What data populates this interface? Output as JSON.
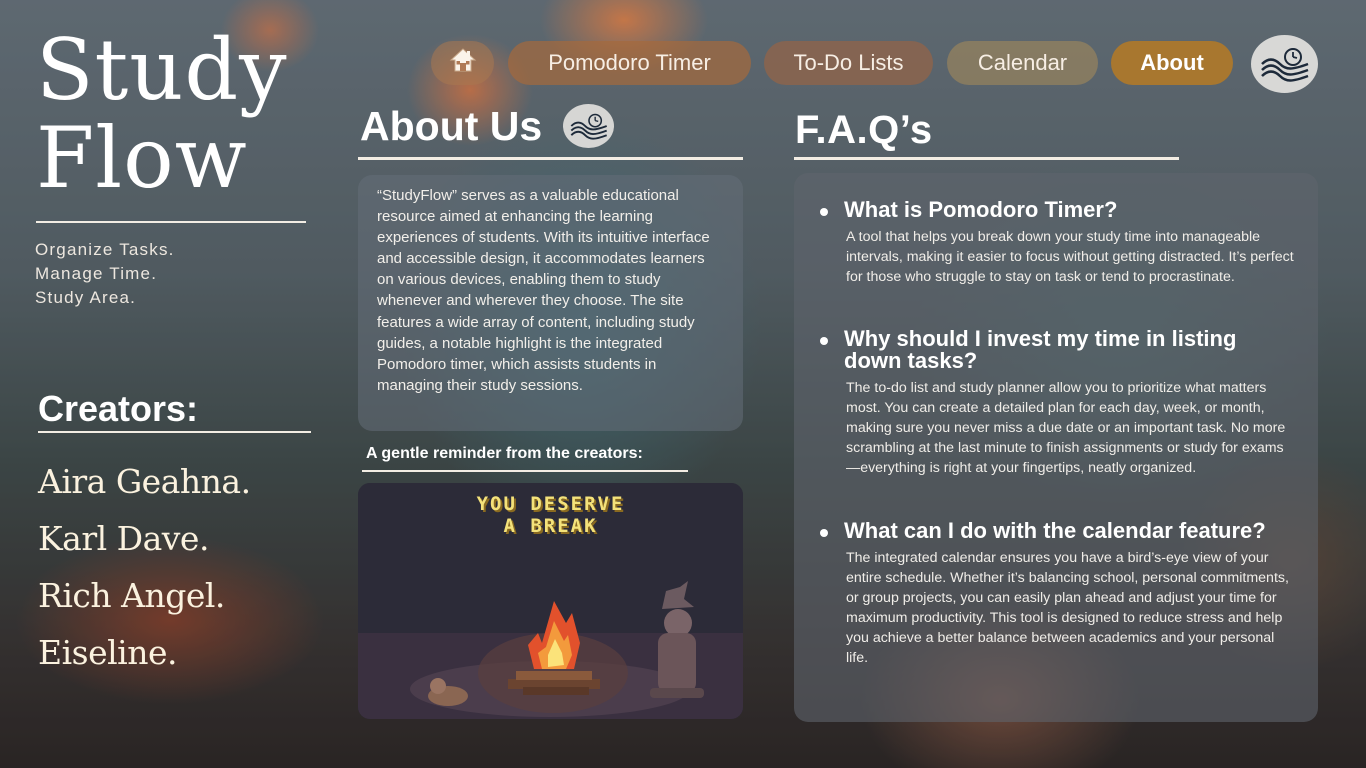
{
  "brand": {
    "title_line1": "Study",
    "title_line2": "Flow",
    "tagline": [
      "Organize Tasks.",
      "Manage Time.",
      "Study Area."
    ]
  },
  "creators": {
    "title": "Creators:",
    "names": [
      "Aira Geahna.",
      "Karl Dave.",
      "Rich Angel.",
      "Eiseline."
    ]
  },
  "nav": {
    "home_icon": "home-icon",
    "items": [
      {
        "label": "Pomodoro Timer"
      },
      {
        "label": "To-Do Lists"
      },
      {
        "label": "Calendar"
      },
      {
        "label": "About",
        "active": true
      }
    ],
    "logo_icon": "studyflow-wave-clock-logo"
  },
  "about": {
    "title": "About Us",
    "body": "“StudyFlow” serves as a valuable educational resource aimed at enhancing the learning experiences of students. With its intuitive interface and accessible design, it accommodates learners on various devices, enabling them to study whenever and wherever they choose. The site features a wide array of content, including study guides, a notable highlight is the integrated Pomodoro timer, which assists students in managing their study sessions.",
    "reminder_label": "A gentle reminder from the creators:",
    "image_text_line1": "YOU DESERVE",
    "image_text_line2": "A BREAK"
  },
  "faq": {
    "title": "F.A.Q’s",
    "items": [
      {
        "question": "What is Pomodoro Timer?",
        "answer": "A tool that helps you break down your study time into manageable intervals, making it easier to focus without getting distracted. It’s perfect for those who struggle to stay on task or tend to procrastinate."
      },
      {
        "question": "Why should I invest my time in listing down tasks?",
        "answer": "The to-do list and study planner allow you to prioritize what matters most. You can create a detailed plan for each day, week, or month, making sure you never miss a due date or an important task. No more scrambling at the last minute to finish assignments or study for exams—everything is right at your fingertips, neatly organized."
      },
      {
        "question": "What can I do with the calendar feature?",
        "answer": "The integrated calendar ensures you have a bird’s-eye view of your entire schedule. Whether it’s balancing school, personal commitments, or group projects, you can easily plan ahead and adjust your time for maximum productivity. This tool is designed to reduce stress and help you achieve a better balance between academics and your personal life."
      }
    ]
  },
  "colors": {
    "active_nav": "#a8772f",
    "text": "#f4f0ea",
    "pixel_text": "#f4e27a"
  }
}
